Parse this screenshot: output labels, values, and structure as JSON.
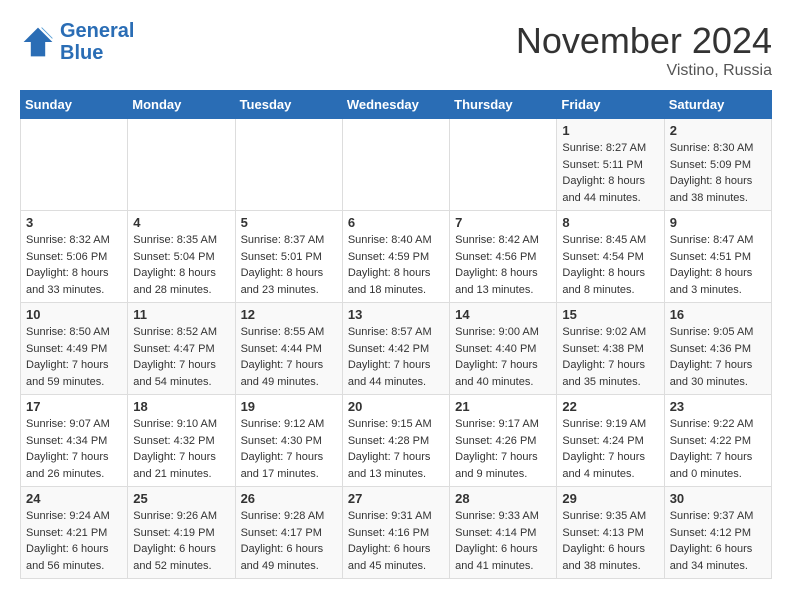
{
  "logo": {
    "line1": "General",
    "line2": "Blue"
  },
  "title": "November 2024",
  "location": "Vistino, Russia",
  "weekdays": [
    "Sunday",
    "Monday",
    "Tuesday",
    "Wednesday",
    "Thursday",
    "Friday",
    "Saturday"
  ],
  "weeks": [
    [
      {
        "day": "",
        "sunrise": "",
        "sunset": "",
        "daylight": ""
      },
      {
        "day": "",
        "sunrise": "",
        "sunset": "",
        "daylight": ""
      },
      {
        "day": "",
        "sunrise": "",
        "sunset": "",
        "daylight": ""
      },
      {
        "day": "",
        "sunrise": "",
        "sunset": "",
        "daylight": ""
      },
      {
        "day": "",
        "sunrise": "",
        "sunset": "",
        "daylight": ""
      },
      {
        "day": "1",
        "sunrise": "Sunrise: 8:27 AM",
        "sunset": "Sunset: 5:11 PM",
        "daylight": "Daylight: 8 hours and 44 minutes."
      },
      {
        "day": "2",
        "sunrise": "Sunrise: 8:30 AM",
        "sunset": "Sunset: 5:09 PM",
        "daylight": "Daylight: 8 hours and 38 minutes."
      }
    ],
    [
      {
        "day": "3",
        "sunrise": "Sunrise: 8:32 AM",
        "sunset": "Sunset: 5:06 PM",
        "daylight": "Daylight: 8 hours and 33 minutes."
      },
      {
        "day": "4",
        "sunrise": "Sunrise: 8:35 AM",
        "sunset": "Sunset: 5:04 PM",
        "daylight": "Daylight: 8 hours and 28 minutes."
      },
      {
        "day": "5",
        "sunrise": "Sunrise: 8:37 AM",
        "sunset": "Sunset: 5:01 PM",
        "daylight": "Daylight: 8 hours and 23 minutes."
      },
      {
        "day": "6",
        "sunrise": "Sunrise: 8:40 AM",
        "sunset": "Sunset: 4:59 PM",
        "daylight": "Daylight: 8 hours and 18 minutes."
      },
      {
        "day": "7",
        "sunrise": "Sunrise: 8:42 AM",
        "sunset": "Sunset: 4:56 PM",
        "daylight": "Daylight: 8 hours and 13 minutes."
      },
      {
        "day": "8",
        "sunrise": "Sunrise: 8:45 AM",
        "sunset": "Sunset: 4:54 PM",
        "daylight": "Daylight: 8 hours and 8 minutes."
      },
      {
        "day": "9",
        "sunrise": "Sunrise: 8:47 AM",
        "sunset": "Sunset: 4:51 PM",
        "daylight": "Daylight: 8 hours and 3 minutes."
      }
    ],
    [
      {
        "day": "10",
        "sunrise": "Sunrise: 8:50 AM",
        "sunset": "Sunset: 4:49 PM",
        "daylight": "Daylight: 7 hours and 59 minutes."
      },
      {
        "day": "11",
        "sunrise": "Sunrise: 8:52 AM",
        "sunset": "Sunset: 4:47 PM",
        "daylight": "Daylight: 7 hours and 54 minutes."
      },
      {
        "day": "12",
        "sunrise": "Sunrise: 8:55 AM",
        "sunset": "Sunset: 4:44 PM",
        "daylight": "Daylight: 7 hours and 49 minutes."
      },
      {
        "day": "13",
        "sunrise": "Sunrise: 8:57 AM",
        "sunset": "Sunset: 4:42 PM",
        "daylight": "Daylight: 7 hours and 44 minutes."
      },
      {
        "day": "14",
        "sunrise": "Sunrise: 9:00 AM",
        "sunset": "Sunset: 4:40 PM",
        "daylight": "Daylight: 7 hours and 40 minutes."
      },
      {
        "day": "15",
        "sunrise": "Sunrise: 9:02 AM",
        "sunset": "Sunset: 4:38 PM",
        "daylight": "Daylight: 7 hours and 35 minutes."
      },
      {
        "day": "16",
        "sunrise": "Sunrise: 9:05 AM",
        "sunset": "Sunset: 4:36 PM",
        "daylight": "Daylight: 7 hours and 30 minutes."
      }
    ],
    [
      {
        "day": "17",
        "sunrise": "Sunrise: 9:07 AM",
        "sunset": "Sunset: 4:34 PM",
        "daylight": "Daylight: 7 hours and 26 minutes."
      },
      {
        "day": "18",
        "sunrise": "Sunrise: 9:10 AM",
        "sunset": "Sunset: 4:32 PM",
        "daylight": "Daylight: 7 hours and 21 minutes."
      },
      {
        "day": "19",
        "sunrise": "Sunrise: 9:12 AM",
        "sunset": "Sunset: 4:30 PM",
        "daylight": "Daylight: 7 hours and 17 minutes."
      },
      {
        "day": "20",
        "sunrise": "Sunrise: 9:15 AM",
        "sunset": "Sunset: 4:28 PM",
        "daylight": "Daylight: 7 hours and 13 minutes."
      },
      {
        "day": "21",
        "sunrise": "Sunrise: 9:17 AM",
        "sunset": "Sunset: 4:26 PM",
        "daylight": "Daylight: 7 hours and 9 minutes."
      },
      {
        "day": "22",
        "sunrise": "Sunrise: 9:19 AM",
        "sunset": "Sunset: 4:24 PM",
        "daylight": "Daylight: 7 hours and 4 minutes."
      },
      {
        "day": "23",
        "sunrise": "Sunrise: 9:22 AM",
        "sunset": "Sunset: 4:22 PM",
        "daylight": "Daylight: 7 hours and 0 minutes."
      }
    ],
    [
      {
        "day": "24",
        "sunrise": "Sunrise: 9:24 AM",
        "sunset": "Sunset: 4:21 PM",
        "daylight": "Daylight: 6 hours and 56 minutes."
      },
      {
        "day": "25",
        "sunrise": "Sunrise: 9:26 AM",
        "sunset": "Sunset: 4:19 PM",
        "daylight": "Daylight: 6 hours and 52 minutes."
      },
      {
        "day": "26",
        "sunrise": "Sunrise: 9:28 AM",
        "sunset": "Sunset: 4:17 PM",
        "daylight": "Daylight: 6 hours and 49 minutes."
      },
      {
        "day": "27",
        "sunrise": "Sunrise: 9:31 AM",
        "sunset": "Sunset: 4:16 PM",
        "daylight": "Daylight: 6 hours and 45 minutes."
      },
      {
        "day": "28",
        "sunrise": "Sunrise: 9:33 AM",
        "sunset": "Sunset: 4:14 PM",
        "daylight": "Daylight: 6 hours and 41 minutes."
      },
      {
        "day": "29",
        "sunrise": "Sunrise: 9:35 AM",
        "sunset": "Sunset: 4:13 PM",
        "daylight": "Daylight: 6 hours and 38 minutes."
      },
      {
        "day": "30",
        "sunrise": "Sunrise: 9:37 AM",
        "sunset": "Sunset: 4:12 PM",
        "daylight": "Daylight: 6 hours and 34 minutes."
      }
    ]
  ]
}
